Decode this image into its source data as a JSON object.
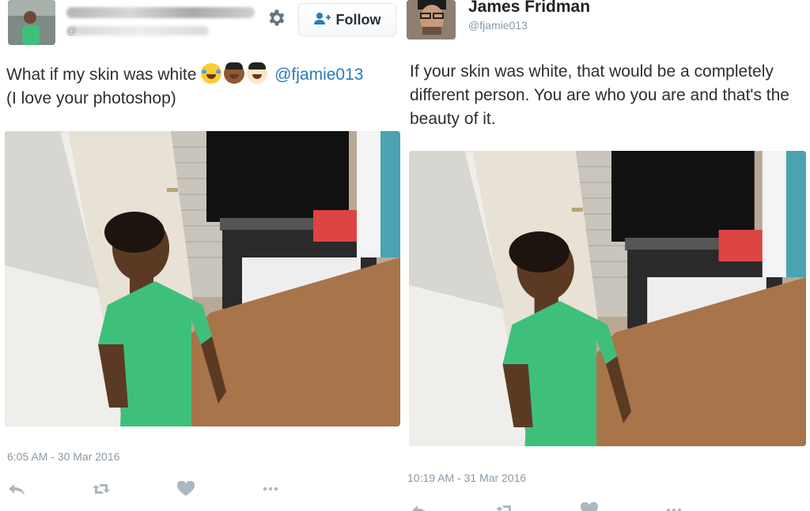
{
  "left_tweet": {
    "follow_label": "Follow",
    "handle_prefix": "@",
    "text_main": "What if my skin was white",
    "mention": "@fjamie013",
    "text_second_line": "(I love your photoshop)",
    "emojis": [
      "face-with-tears-of-joy",
      "medium-dark-skin-boy",
      "light-skin-boy"
    ],
    "timestamp": "6:05 AM - 30 Mar 2016"
  },
  "right_tweet": {
    "user_name": "James Fridman",
    "user_handle": "@fjamie013",
    "text": "If your skin was white, that would be a completely different person. You are who you are and that's the beauty of it.",
    "timestamp": "10:19 AM - 31 Mar 2016"
  },
  "icons": {
    "settings": "gear-icon",
    "follow": "add-user-icon",
    "reply": "reply-icon",
    "retweet": "retweet-icon",
    "like": "heart-icon",
    "more": "more-icon"
  },
  "colors": {
    "link": "#2b7bb9",
    "meta_text": "#8899a6",
    "icon": "#aab8c2",
    "shirt": "#3fc07a"
  }
}
